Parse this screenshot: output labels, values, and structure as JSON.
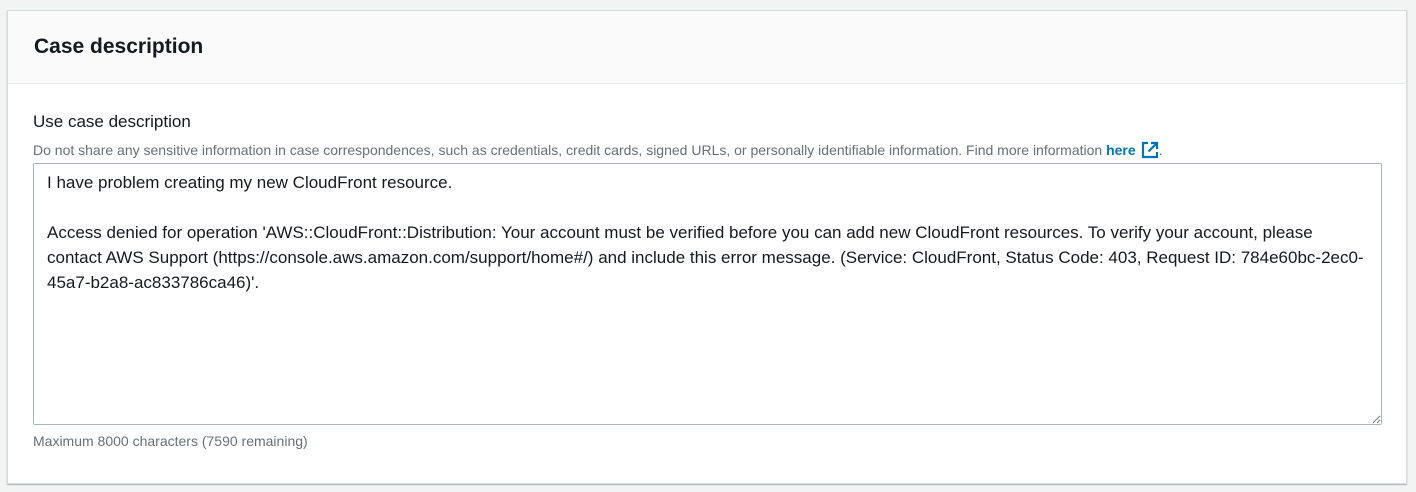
{
  "header": {
    "title": "Case description"
  },
  "field": {
    "label": "Use case description",
    "description": "Do not share any sensitive information in case correspondences, such as credentials, credit cards, signed URLs, or personally identifiable information. Find more information ",
    "link_text": "here",
    "link_icon": "external-link-icon",
    "trailing": ".",
    "value": "I have problem creating my new CloudFront resource.\n\nAccess denied for operation 'AWS::CloudFront::Distribution: Your account must be verified before you can add new CloudFront resources. To verify your account, please contact AWS Support (https://console.aws.amazon.com/support/home#/) and include this error message. (Service: CloudFront, Status Code: 403, Request ID: 784e60bc-2ec0-45a7-b2a8-ac833786ca46)'.",
    "constraint": "Maximum 8000 characters (7590 remaining)"
  },
  "colors": {
    "link": "#0073bb",
    "text": "#16191f",
    "muted": "#687078",
    "border": "#aab7b8"
  }
}
